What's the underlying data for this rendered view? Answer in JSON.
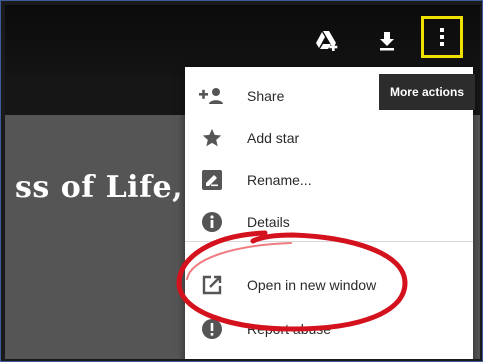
{
  "document": {
    "title_fragment": "ss of Life,"
  },
  "toolbar": {
    "icons": [
      "google-drive-add-icon",
      "download-icon",
      "more-vert-icon"
    ]
  },
  "tooltip": {
    "text": "More actions"
  },
  "menu": {
    "items": [
      {
        "label": "Share",
        "icon": "person-add-icon"
      },
      {
        "label": "Add star",
        "icon": "star-icon"
      },
      {
        "label": "Rename...",
        "icon": "edit-icon"
      },
      {
        "label": "Details",
        "icon": "info-icon"
      },
      {
        "label": "Open in new window",
        "icon": "open-in-new-icon"
      },
      {
        "label": "Report abuse",
        "icon": "report-icon"
      }
    ]
  },
  "colors": {
    "highlight_box": "#f0e000",
    "annotation_ring": "#d4121e",
    "frame_border": "#3d5a9a"
  }
}
